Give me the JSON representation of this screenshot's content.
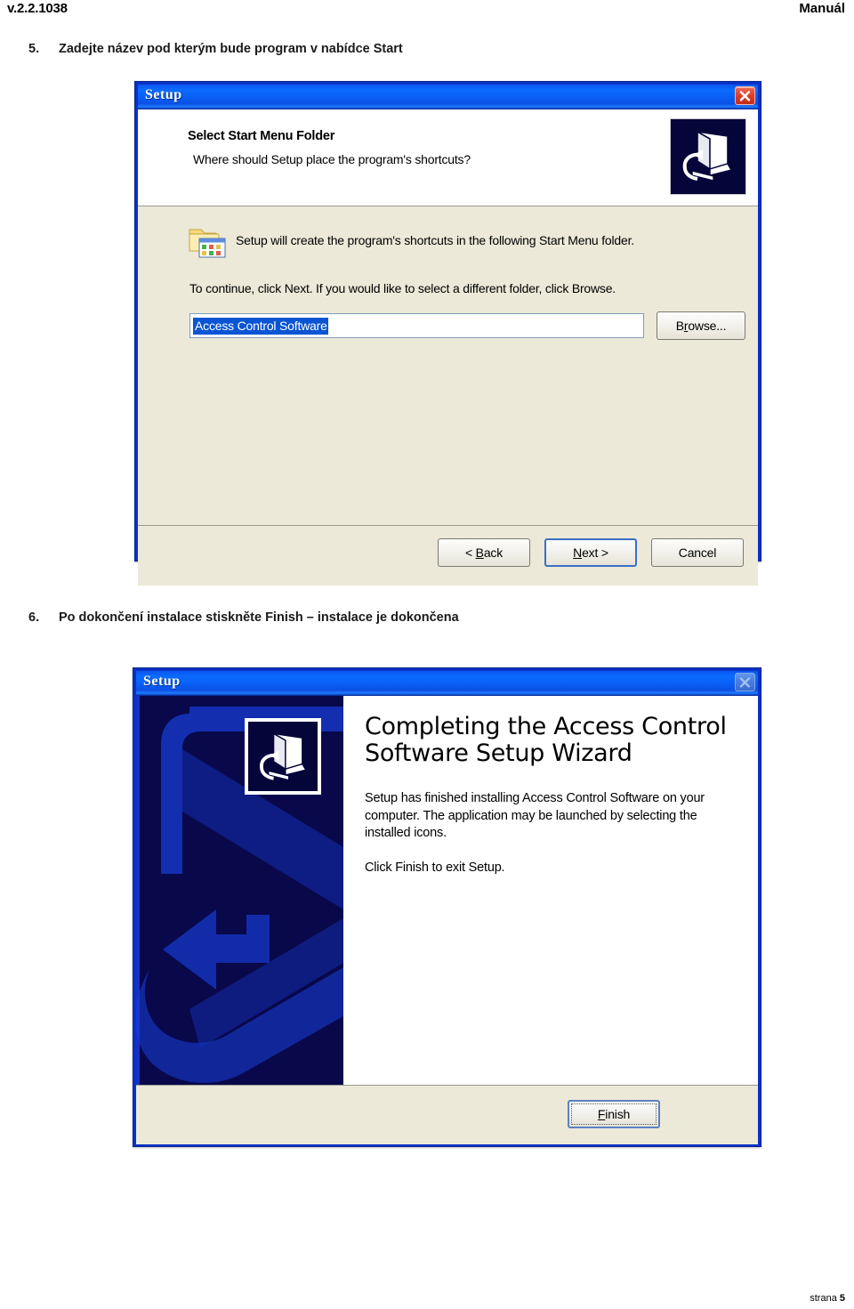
{
  "page": {
    "header_left": "v.2.2.1038",
    "header_right": "Manuál",
    "footer_label": "strana",
    "footer_page": "5"
  },
  "steps": [
    {
      "number": "5.",
      "text": "Zadejte název pod kterým bude program v nabídce Start"
    },
    {
      "number": "6.",
      "text": "Po dokončení instalace stiskněte Finish – instalace je dokončena"
    }
  ],
  "dialog1": {
    "title": "Setup",
    "close_icon": "close-icon",
    "header_icon": "setup-computer-icon",
    "heading": "Select Start Menu Folder",
    "subheading": "Where should Setup place the program's shortcuts?",
    "folder_icon": "folder-with-shortcuts-icon",
    "body_line1": "Setup will create the program's shortcuts in the following Start Menu folder.",
    "body_line2": "To continue, click Next. If you would like to select a different folder, click Browse.",
    "folder_field_value": "Access Control Software",
    "browse_label": "Browse...",
    "buttons": {
      "back": "< Back",
      "next": "Next >",
      "cancel": "Cancel"
    }
  },
  "dialog2": {
    "title": "Setup",
    "close_icon": "close-icon-disabled",
    "side_icon": "setup-computer-icon",
    "wizard_title": "Completing the Access Control Software Setup Wizard",
    "paragraph1": "Setup has finished installing Access Control Software on your computer. The application may be launched by selecting the installed icons.",
    "paragraph2": "Click Finish to exit Setup.",
    "finish_label": "Finish"
  },
  "colors": {
    "titlebar_blue": "#0b6cff",
    "dialog_face": "#ece9d8",
    "selection_blue": "#0a55d4",
    "side_panel_navy": "#08084a",
    "close_red": "#c42a16"
  }
}
